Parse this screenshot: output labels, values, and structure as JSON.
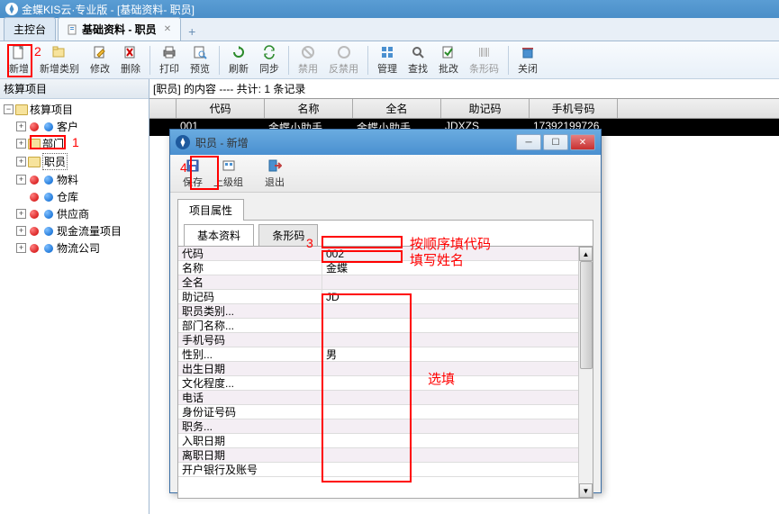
{
  "window": {
    "title": "金蝶KIS云·专业版 - [基础资料- 职员]"
  },
  "tabs": {
    "main": "主控台",
    "active": "基础资料 - 职员"
  },
  "toolbar": {
    "new": "新增",
    "newcat": "新增类别",
    "edit": "修改",
    "del": "删除",
    "print": "打印",
    "preview": "预览",
    "refresh": "刷新",
    "sync": "同步",
    "disable": "禁用",
    "enable": "反禁用",
    "manage": "管理",
    "search": "查找",
    "approve": "批改",
    "barcode": "条形码",
    "close": "关闭"
  },
  "sidebar": {
    "title": "核算项目",
    "root": "核算项目",
    "items": [
      "客户",
      "部门",
      "职员",
      "物料",
      "仓库",
      "供应商",
      "现金流量项目",
      "物流公司"
    ]
  },
  "content": {
    "header": "[职员] 的内容 ---- 共计: 1 条记录",
    "cols": [
      "代码",
      "名称",
      "全名",
      "助记码",
      "手机号码"
    ],
    "row": {
      "code": "001",
      "name": "金蝶小助手",
      "fullname": "金蝶小助手",
      "mnemonic": "JDXZS",
      "phone": "17392199726"
    }
  },
  "dialog": {
    "title": "职员 - 新增",
    "tb": {
      "save": "保存",
      "parent": "上级组",
      "exit": "退出"
    },
    "tab1": "项目属性",
    "subtab1": "基本资料",
    "subtab2": "条形码",
    "props": [
      {
        "k": "代码",
        "v": "002"
      },
      {
        "k": "名称",
        "v": "金蝶"
      },
      {
        "k": "全名",
        "v": ""
      },
      {
        "k": "助记码",
        "v": "JD"
      },
      {
        "k": "职员类别...",
        "v": ""
      },
      {
        "k": "部门名称...",
        "v": ""
      },
      {
        "k": "手机号码",
        "v": ""
      },
      {
        "k": "性别...",
        "v": "男"
      },
      {
        "k": "出生日期",
        "v": ""
      },
      {
        "k": "文化程度...",
        "v": ""
      },
      {
        "k": "电话",
        "v": ""
      },
      {
        "k": "身份证号码",
        "v": ""
      },
      {
        "k": "职务...",
        "v": ""
      },
      {
        "k": "入职日期",
        "v": ""
      },
      {
        "k": "离职日期",
        "v": ""
      },
      {
        "k": "开户银行及账号",
        "v": ""
      }
    ]
  },
  "annotations": {
    "n1": "1",
    "n2": "2",
    "n3": "3",
    "n4": "4",
    "t1": "按顺序填代码",
    "t2": "填写姓名",
    "t3": "选填"
  }
}
